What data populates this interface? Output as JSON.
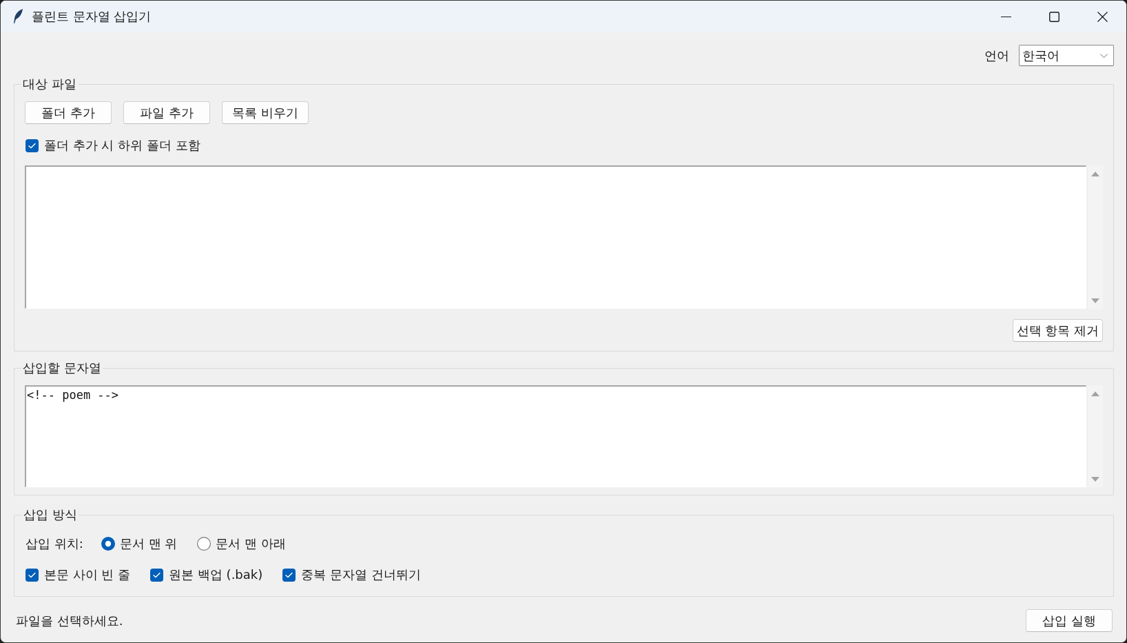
{
  "window": {
    "title": "플린트 문자열 삽입기"
  },
  "language": {
    "label": "언어",
    "value": "한국어"
  },
  "target_files": {
    "title": "대상 파일",
    "buttons": [
      "폴더 추가",
      "파일 추가",
      "목록 비우기"
    ],
    "include_subfolders": {
      "label": "폴더 추가 시 하위 폴더 포함",
      "checked": true
    },
    "remove_button": "선택 항목 제거"
  },
  "insert_string": {
    "title": "삽입할 문자열",
    "value": "<!-- poem -->"
  },
  "insert_mode": {
    "title": "삽입 방식",
    "position_label": "삽입 위치:",
    "positions": [
      {
        "label": "문서 맨 위",
        "selected": true
      },
      {
        "label": "문서 맨 아래",
        "selected": false
      }
    ],
    "options": [
      {
        "label": "본문 사이 빈 줄",
        "checked": true
      },
      {
        "label": "원본 백업 (.bak)",
        "checked": true
      },
      {
        "label": "중복 문자열 건너뛰기",
        "checked": true
      }
    ]
  },
  "status_bar": {
    "text": "파일을 선택하세요.",
    "run_button": "삽입 실행"
  }
}
